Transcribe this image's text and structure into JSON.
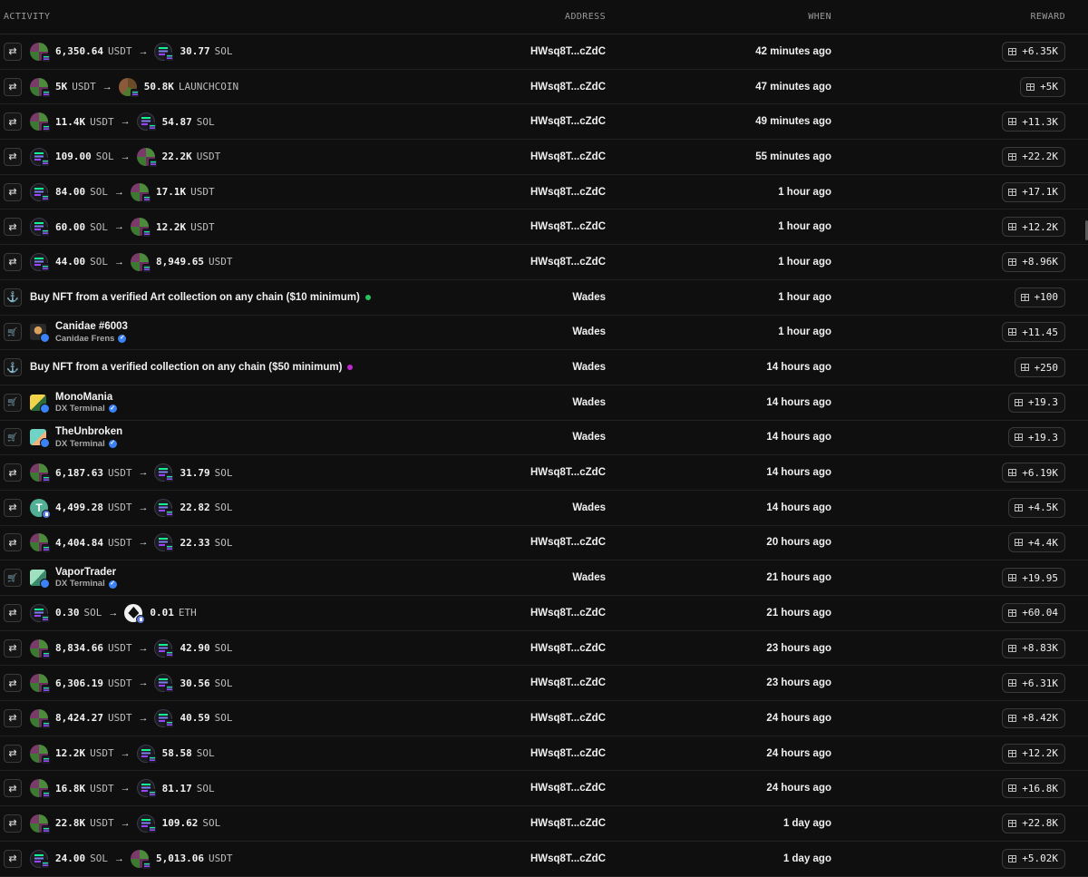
{
  "header": {
    "activity": "ACTIVITY",
    "address": "ADDRESS",
    "when": "WHEN",
    "reward": "REWARD"
  },
  "colors": {
    "background": "#0f0f0f",
    "verified": "#3b82f6",
    "green_dot": "#22c55e",
    "purple_dot": "#c026d3"
  },
  "rows": [
    {
      "kind": "swap",
      "from_amt": "6,350.64",
      "from_sym": "USDT",
      "from_icon": "usdt",
      "to_amt": "30.77",
      "to_sym": "SOL",
      "to_icon": "sol",
      "address": "HWsq8T...cZdC",
      "when": "42 minutes ago",
      "reward": "+6.35K"
    },
    {
      "kind": "swap",
      "from_amt": "5K",
      "from_sym": "USDT",
      "from_icon": "usdt",
      "to_amt": "50.8K",
      "to_sym": "LAUNCHCOIN",
      "to_icon": "launch",
      "address": "HWsq8T...cZdC",
      "when": "47 minutes ago",
      "reward": "+5K"
    },
    {
      "kind": "swap",
      "from_amt": "11.4K",
      "from_sym": "USDT",
      "from_icon": "usdt",
      "to_amt": "54.87",
      "to_sym": "SOL",
      "to_icon": "sol",
      "address": "HWsq8T...cZdC",
      "when": "49 minutes ago",
      "reward": "+11.3K"
    },
    {
      "kind": "swap",
      "from_amt": "109.00",
      "from_sym": "SOL",
      "from_icon": "sol",
      "to_amt": "22.2K",
      "to_sym": "USDT",
      "to_icon": "usdt",
      "address": "HWsq8T...cZdC",
      "when": "55 minutes ago",
      "reward": "+22.2K"
    },
    {
      "kind": "swap",
      "from_amt": "84.00",
      "from_sym": "SOL",
      "from_icon": "sol",
      "to_amt": "17.1K",
      "to_sym": "USDT",
      "to_icon": "usdt",
      "address": "HWsq8T...cZdC",
      "when": "1 hour ago",
      "reward": "+17.1K"
    },
    {
      "kind": "swap",
      "from_amt": "60.00",
      "from_sym": "SOL",
      "from_icon": "sol",
      "to_amt": "12.2K",
      "to_sym": "USDT",
      "to_icon": "usdt",
      "address": "HWsq8T...cZdC",
      "when": "1 hour ago",
      "reward": "+12.2K"
    },
    {
      "kind": "swap",
      "from_amt": "44.00",
      "from_sym": "SOL",
      "from_icon": "sol",
      "to_amt": "8,949.65",
      "to_sym": "USDT",
      "to_icon": "usdt",
      "address": "HWsq8T...cZdC",
      "when": "1 hour ago",
      "reward": "+8.96K"
    },
    {
      "kind": "quest",
      "text": "Buy NFT from a verified Art collection on any chain ($10 minimum)",
      "dot": "green",
      "address": "Wades",
      "when": "1 hour ago",
      "reward": "+100"
    },
    {
      "kind": "nft",
      "name": "Canidae #6003",
      "collection": "Canidae Frens",
      "thumb": "canidae",
      "address": "Wades",
      "when": "1 hour ago",
      "reward": "+11.45"
    },
    {
      "kind": "quest",
      "text": "Buy NFT from a verified collection on any chain ($50 minimum)",
      "dot": "purple",
      "address": "Wades",
      "when": "14 hours ago",
      "reward": "+250"
    },
    {
      "kind": "nft",
      "name": "MonoMania",
      "collection": "DX Terminal",
      "thumb": "mono",
      "address": "Wades",
      "when": "14 hours ago",
      "reward": "+19.3"
    },
    {
      "kind": "nft",
      "name": "TheUnbroken",
      "collection": "DX Terminal",
      "thumb": "unbroken",
      "address": "Wades",
      "when": "14 hours ago",
      "reward": "+19.3"
    },
    {
      "kind": "swap",
      "from_amt": "6,187.63",
      "from_sym": "USDT",
      "from_icon": "usdt",
      "to_amt": "31.79",
      "to_sym": "SOL",
      "to_icon": "sol",
      "address": "HWsq8T...cZdC",
      "when": "14 hours ago",
      "reward": "+6.19K"
    },
    {
      "kind": "swap",
      "from_amt": "4,499.28",
      "from_sym": "USDT",
      "from_icon": "tether",
      "to_amt": "22.82",
      "to_sym": "SOL",
      "to_icon": "sol",
      "address": "Wades",
      "when": "14 hours ago",
      "reward": "+4.5K"
    },
    {
      "kind": "swap",
      "from_amt": "4,404.84",
      "from_sym": "USDT",
      "from_icon": "usdt",
      "to_amt": "22.33",
      "to_sym": "SOL",
      "to_icon": "sol",
      "address": "HWsq8T...cZdC",
      "when": "20 hours ago",
      "reward": "+4.4K"
    },
    {
      "kind": "nft",
      "name": "VaporTrader",
      "collection": "DX Terminal",
      "thumb": "vapor",
      "address": "Wades",
      "when": "21 hours ago",
      "reward": "+19.95"
    },
    {
      "kind": "swap",
      "from_amt": "0.30",
      "from_sym": "SOL",
      "from_icon": "sol",
      "to_amt": "0.01",
      "to_sym": "ETH",
      "to_icon": "eth",
      "address": "HWsq8T...cZdC",
      "when": "21 hours ago",
      "reward": "+60.04"
    },
    {
      "kind": "swap",
      "from_amt": "8,834.66",
      "from_sym": "USDT",
      "from_icon": "usdt",
      "to_amt": "42.90",
      "to_sym": "SOL",
      "to_icon": "sol",
      "address": "HWsq8T...cZdC",
      "when": "23 hours ago",
      "reward": "+8.83K"
    },
    {
      "kind": "swap",
      "from_amt": "6,306.19",
      "from_sym": "USDT",
      "from_icon": "usdt",
      "to_amt": "30.56",
      "to_sym": "SOL",
      "to_icon": "sol",
      "address": "HWsq8T...cZdC",
      "when": "23 hours ago",
      "reward": "+6.31K"
    },
    {
      "kind": "swap",
      "from_amt": "8,424.27",
      "from_sym": "USDT",
      "from_icon": "usdt",
      "to_amt": "40.59",
      "to_sym": "SOL",
      "to_icon": "sol",
      "address": "HWsq8T...cZdC",
      "when": "24 hours ago",
      "reward": "+8.42K"
    },
    {
      "kind": "swap",
      "from_amt": "12.2K",
      "from_sym": "USDT",
      "from_icon": "usdt",
      "to_amt": "58.58",
      "to_sym": "SOL",
      "to_icon": "sol",
      "address": "HWsq8T...cZdC",
      "when": "24 hours ago",
      "reward": "+12.2K"
    },
    {
      "kind": "swap",
      "from_amt": "16.8K",
      "from_sym": "USDT",
      "from_icon": "usdt",
      "to_amt": "81.17",
      "to_sym": "SOL",
      "to_icon": "sol",
      "address": "HWsq8T...cZdC",
      "when": "24 hours ago",
      "reward": "+16.8K"
    },
    {
      "kind": "swap",
      "from_amt": "22.8K",
      "from_sym": "USDT",
      "from_icon": "usdt",
      "to_amt": "109.62",
      "to_sym": "SOL",
      "to_icon": "sol",
      "address": "HWsq8T...cZdC",
      "when": "1 day ago",
      "reward": "+22.8K"
    },
    {
      "kind": "swap",
      "from_amt": "24.00",
      "from_sym": "SOL",
      "from_icon": "sol",
      "to_amt": "5,013.06",
      "to_sym": "USDT",
      "to_icon": "usdt",
      "address": "HWsq8T...cZdC",
      "when": "1 day ago",
      "reward": "+5.02K"
    }
  ]
}
